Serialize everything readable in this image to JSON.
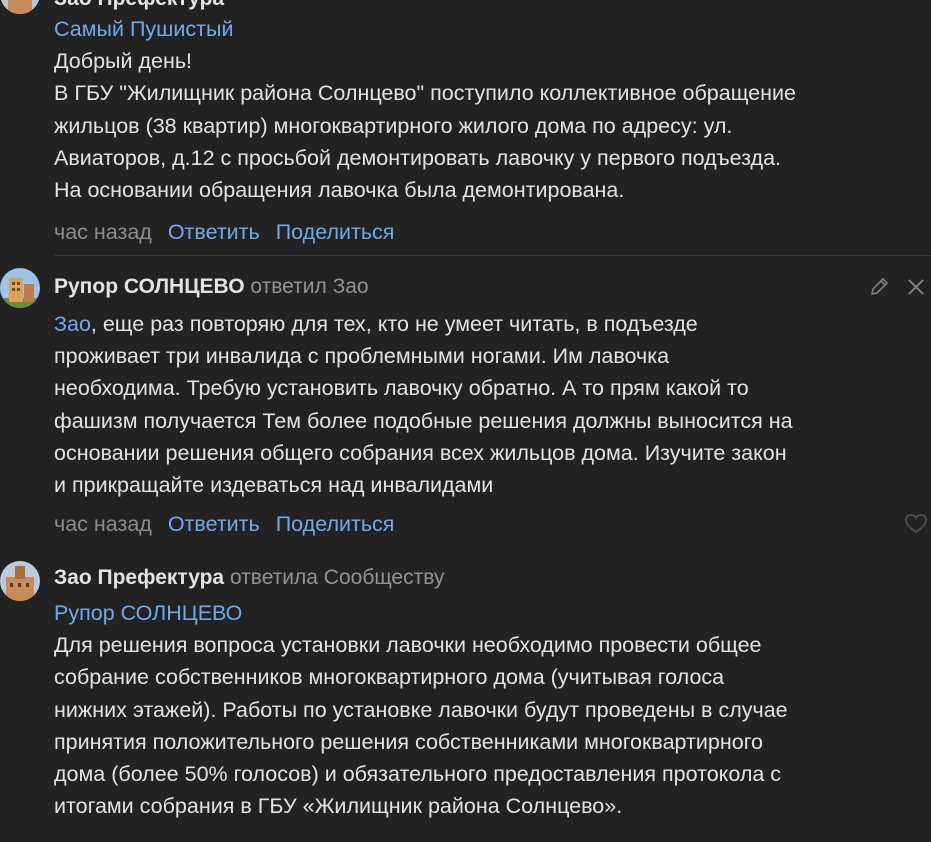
{
  "comments": [
    {
      "author": "Зао Префектура",
      "reply_to_link": "Самый Пушистый",
      "text_lines": [
        "Добрый день!",
        "В ГБУ \"Жилищник района Солнцево\" поступило коллективное обращение",
        "жильцов (38 квартир) многоквартирного жилого дома по адресу: ул.",
        "Авиаторов, д.12 с просьбой демонтировать лавочку у первого подъезда.",
        "На основании обращения лавочка была демонтирована."
      ],
      "time": "час назад",
      "reply_label": "Ответить",
      "share_label": "Поделиться"
    },
    {
      "author": "Рупор СОЛНЦЕВО",
      "reply_info": "ответил Зао",
      "mention": "Зао",
      "text_first_rest": ", еще раз повторяю для тех, кто не умеет читать, в подъезде",
      "text_lines": [
        "проживает три инвалида с проблемными ногами. Им лавочка",
        "необходима. Требую установить лавочку обратно. А то прям какой то",
        "фашизм получается Тем более подобные решения должны выносится на",
        "основании решения общего собрания всех жильцов дома. Изучите закон",
        "и прикращайте издеваться над инвалидами"
      ],
      "time": "час назад",
      "reply_label": "Ответить",
      "share_label": "Поделиться"
    },
    {
      "author": "Зао Префектура",
      "reply_info": "ответила Сообществу",
      "reply_to_link": "Рупор СОЛНЦЕВО",
      "text_lines": [
        "Для решения вопроса установки лавочки необходимо провести общее",
        "собрание собственников многоквартирного дома (учитывая голоса",
        "нижних этажей). Работы по установке лавочки будут проведены в случае",
        "принятия положительного решения собственниками многоквартирного",
        "дома (более 50% голосов) и обязательного предоставления протокола с",
        "итогами собрания в ГБУ «Жилищник района Солнцево»."
      ]
    }
  ],
  "colors": {
    "background": "#222222",
    "text": "#e1e3e6",
    "link": "#71aaeb",
    "secondary": "#939393"
  },
  "icons": [
    "pencil-icon",
    "close-icon",
    "heart-icon"
  ]
}
